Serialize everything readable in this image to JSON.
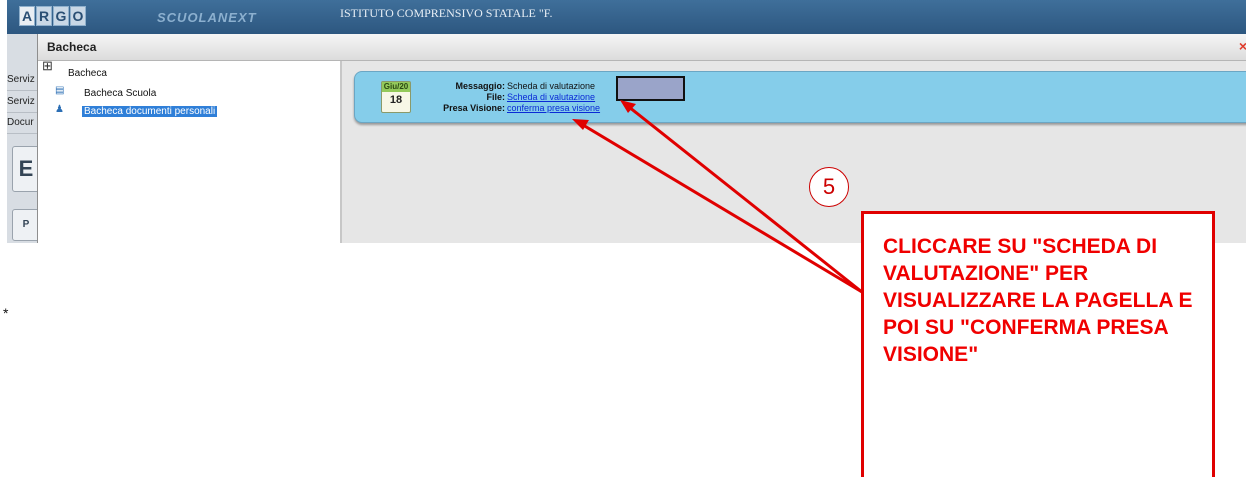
{
  "app": {
    "logo_letters": [
      "A",
      "R",
      "G",
      "O"
    ],
    "brand": "SCUOLANEXT",
    "school_name": "ISTITUTO COMPRENSIVO STATALE \"F."
  },
  "left_strip": {
    "items": [
      "Serviz",
      "Serviz",
      "Docur"
    ],
    "buttons": [
      "E",
      "P"
    ]
  },
  "window": {
    "title": "Bacheca",
    "close_glyph": "×",
    "tree": {
      "root": "Bacheca",
      "children": [
        "Bacheca Scuola",
        "Bacheca documenti personali"
      ],
      "selected_index": 1
    }
  },
  "message": {
    "calendar_month": "Giu/20",
    "calendar_day": "18",
    "messaggio_label": "Messaggio:",
    "messaggio_value": "Scheda di valutazione",
    "file_label": "File:",
    "file_link": "Scheda di valutazione",
    "presa_label": "Presa Visione:",
    "presa_link": "conferma presa visione"
  },
  "annotation": {
    "step_number": "5",
    "callout_text": "CLICCARE SU \"SCHEDA DI VALUTAZIONE\" PER VISUALIZZARE LA PAGELLA E POI SU \"CONFERMA PRESA VISIONE\"",
    "color": "#e00000"
  },
  "footnote": "*"
}
